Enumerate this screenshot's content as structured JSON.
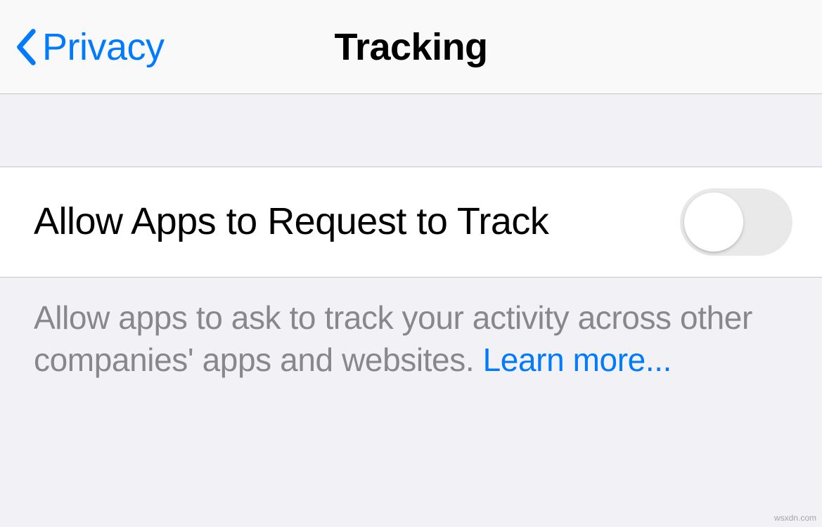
{
  "nav": {
    "back_label": "Privacy",
    "title": "Tracking"
  },
  "setting": {
    "label": "Allow Apps to Request to Track",
    "toggle_on": false
  },
  "footer": {
    "description": "Allow apps to ask to track your activity across other companies' apps and websites. ",
    "learn_more_label": "Learn more..."
  },
  "watermark": "wsxdn.com"
}
